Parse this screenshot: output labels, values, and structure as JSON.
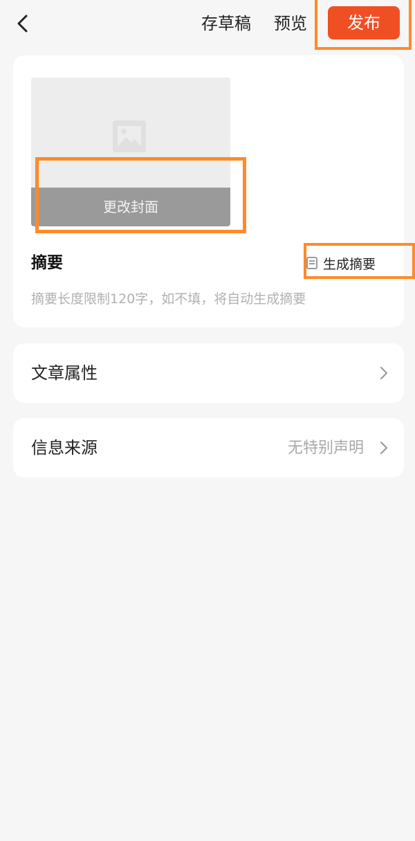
{
  "topbar": {
    "back_icon": "chevron-left-icon",
    "draft_label": "存草稿",
    "preview_label": "预览",
    "publish_label": "发布"
  },
  "cover": {
    "placeholder_icon": "image-placeholder-icon",
    "change_label": "更改封面"
  },
  "summary": {
    "title": "摘要",
    "generate_icon": "document-icon",
    "generate_label": "生成摘要",
    "hint": "摘要长度限制120字，如不填，将自动生成摘要"
  },
  "rows": {
    "attributes": {
      "label": "文章属性",
      "icon": "chevron-right-icon"
    },
    "source": {
      "label": "信息来源",
      "value": "无特别声明",
      "icon": "chevron-right-icon"
    }
  },
  "colors": {
    "accent": "#f04f24",
    "highlight": "#ff8a2a",
    "background": "#f6f6f6",
    "card": "#ffffff",
    "hint_text": "#b0b0b0"
  }
}
